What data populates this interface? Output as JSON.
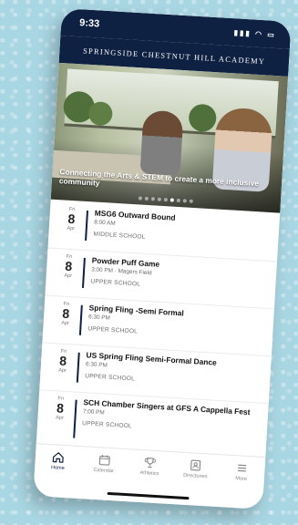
{
  "status": {
    "time": "9:33"
  },
  "header": {
    "title": "SPRINGSIDE CHESTNUT HILL ACADEMY"
  },
  "hero": {
    "caption": "Connecting the Arts & STEM to create a more inclusive community",
    "slides": 9,
    "active_slide": 5
  },
  "events": [
    {
      "dow": "Fri",
      "day": "8",
      "month": "Apr",
      "title": "MSG6 Outward Bound",
      "time": "8:00 AM",
      "school": "MIDDLE SCHOOL"
    },
    {
      "dow": "Fri",
      "day": "8",
      "month": "Apr",
      "title": "Powder Puff Game",
      "time": "3:00 PM · Magers Field",
      "school": "UPPER SCHOOL"
    },
    {
      "dow": "Fri",
      "day": "8",
      "month": "Apr",
      "title": "Spring Fling -Semi Formal",
      "time": "6:30 PM",
      "school": "UPPER SCHOOL"
    },
    {
      "dow": "Fri",
      "day": "8",
      "month": "Apr",
      "title": "US Spring Fling Semi-Formal Dance",
      "time": "6:30 PM",
      "school": "UPPER SCHOOL"
    },
    {
      "dow": "Fri",
      "day": "8",
      "month": "Apr",
      "title": "SCH Chamber Singers at GFS A Cappella Fest",
      "time": "7:00 PM",
      "school": "UPPER SCHOOL"
    }
  ],
  "tabs": [
    {
      "label": "Home",
      "icon": "home-icon",
      "active": true
    },
    {
      "label": "Calendar",
      "icon": "calendar-icon",
      "active": false
    },
    {
      "label": "Athletics",
      "icon": "trophy-icon",
      "active": false
    },
    {
      "label": "Directories",
      "icon": "directory-icon",
      "active": false
    },
    {
      "label": "More",
      "icon": "menu-icon",
      "active": false
    }
  ]
}
